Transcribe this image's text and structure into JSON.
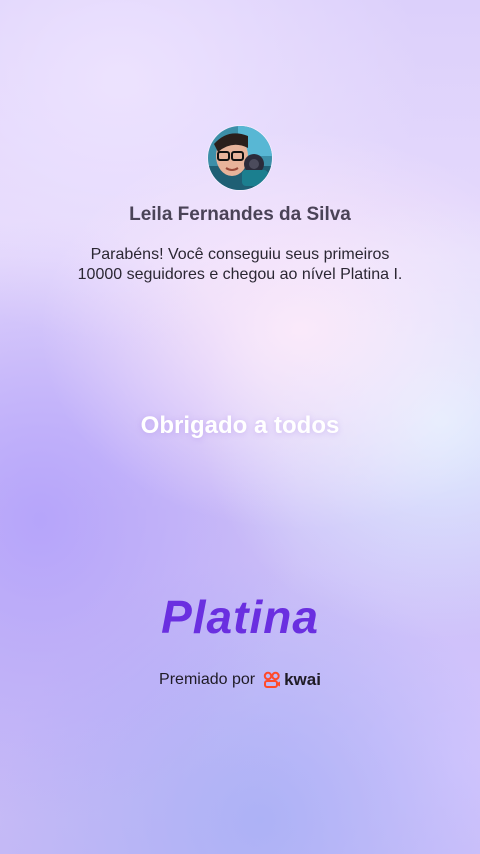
{
  "profile": {
    "name": "Leila Fernandes da Silva",
    "avatar_icon": "profile-photo"
  },
  "message": {
    "line1": "Parabéns! Você conseguiu seus primeiros",
    "line2": "10000 seguidores e chegou ao nível Platina I."
  },
  "thanks_text": "Obrigado a todos",
  "level": {
    "title": "Platina",
    "color": "#6a2fe0"
  },
  "award": {
    "prefix": "Premiado por",
    "brand_name": "kwai",
    "brand_icon": "kwai-logo-icon",
    "brand_color": "#ff4a2a"
  }
}
